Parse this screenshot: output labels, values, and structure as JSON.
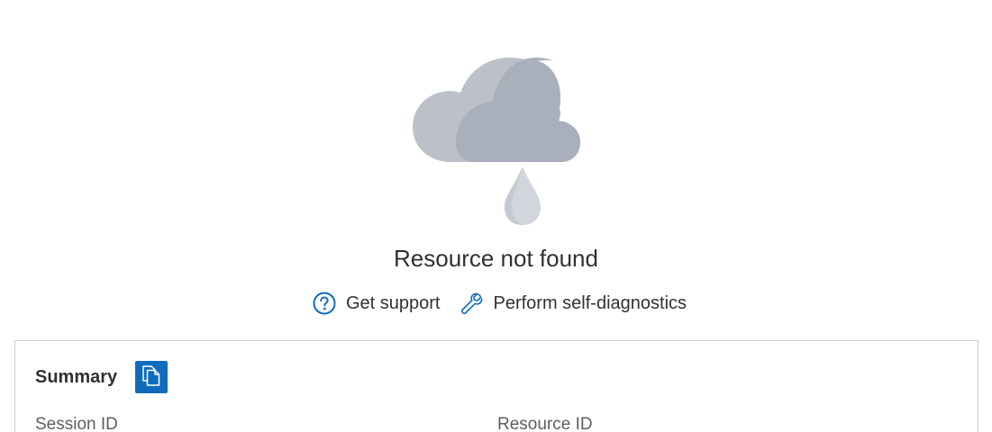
{
  "error": {
    "title": "Resource not found",
    "illustration": "cloud-rain-icon"
  },
  "actions": {
    "support": {
      "label": "Get support",
      "icon": "question-circle-icon"
    },
    "diagnostics": {
      "label": "Perform self-diagnostics",
      "icon": "wrench-icon"
    }
  },
  "summary": {
    "title": "Summary",
    "copy_icon": "copy-icon",
    "fields": {
      "session_id_label": "Session ID",
      "resource_id_label": "Resource ID"
    }
  },
  "colors": {
    "accent": "#0f6cbd",
    "cloud_light": "#bcc1c9",
    "cloud_dark": "#a9afbb",
    "drop": "#d2d6dc"
  }
}
